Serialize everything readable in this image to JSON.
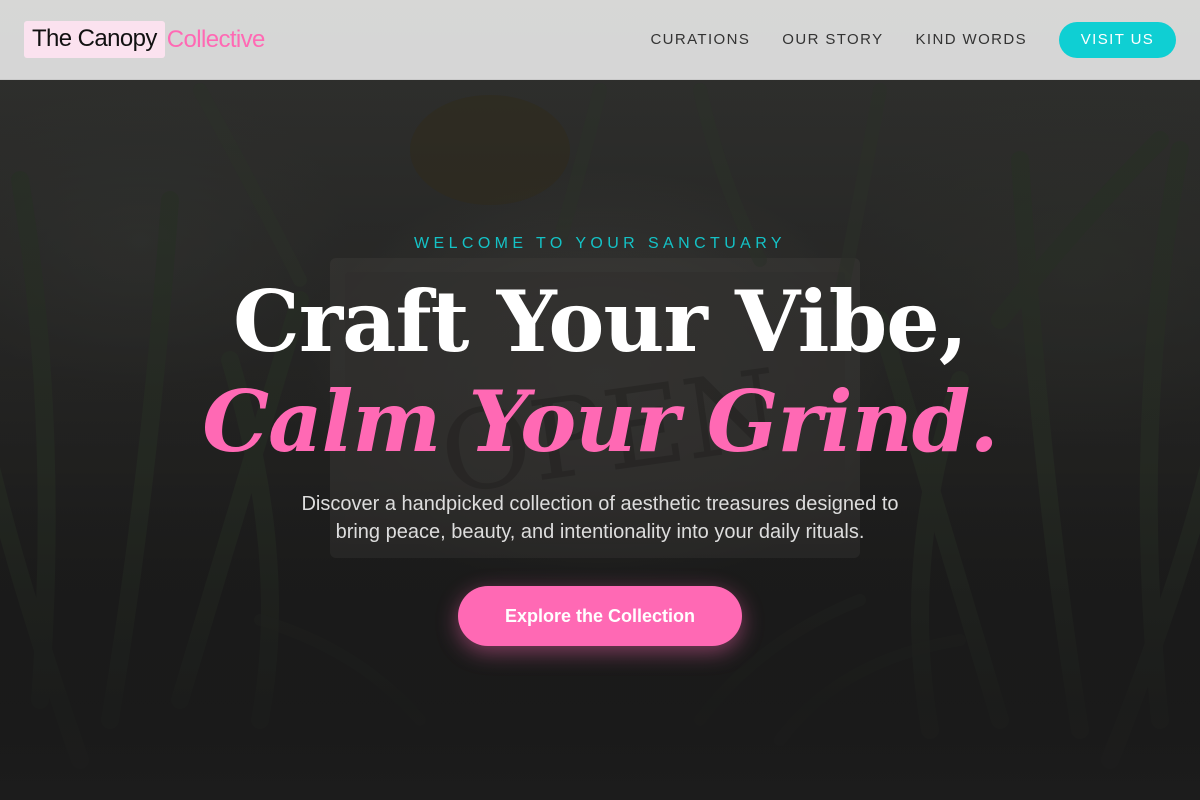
{
  "header": {
    "logo_main": "The Canopy",
    "logo_accent": "Collective",
    "nav": [
      {
        "label": "CURATIONS"
      },
      {
        "label": "OUR STORY"
      },
      {
        "label": "KIND WORDS"
      }
    ],
    "cta_label": "VISIT US"
  },
  "hero": {
    "eyebrow": "WELCOME TO YOUR SANCTUARY",
    "headline_line1": "Craft Your Vibe,",
    "headline_line2": "Calm Your Grind.",
    "subtext_line1": "Discover a handpicked collection of aesthetic treasures designed to",
    "subtext_line2": "bring peace, beauty, and intentionality into your daily rituals.",
    "cta_label": "Explore the Collection"
  },
  "colors": {
    "accent_pink": "#ff69b4",
    "accent_teal": "#0fcfd3",
    "background": "#1c1c1c",
    "header_bg": "#e1e1e1"
  }
}
